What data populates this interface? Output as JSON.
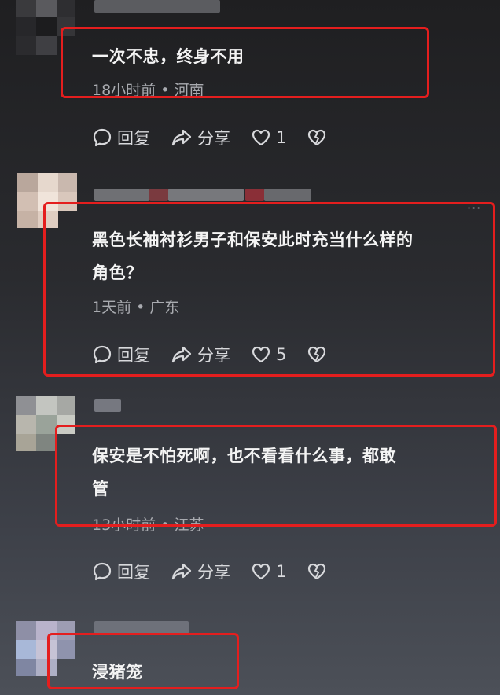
{
  "comments": [
    {
      "text": "一次不忠，终身不用",
      "meta": "18小时前 • 河南",
      "actions": {
        "reply": "回复",
        "share": "分享",
        "likes": "1"
      }
    },
    {
      "text_lines": [
        "黑色长袖衬衫男子和保安此时充当什么样的",
        "角色？"
      ],
      "meta": "1天前 • 广东",
      "actions": {
        "reply": "回复",
        "share": "分享",
        "likes": "5"
      }
    },
    {
      "text_lines": [
        "保安是不怕死啊，也不看看什么事，都敢",
        "管"
      ],
      "meta": "13小时前 • 江苏",
      "actions": {
        "reply": "回复",
        "share": "分享",
        "likes": "1"
      }
    },
    {
      "text": "浸猪笼"
    }
  ],
  "more_label": "···",
  "colors": {
    "highlight": "#e41e1e",
    "meta": "#a9abb0"
  }
}
